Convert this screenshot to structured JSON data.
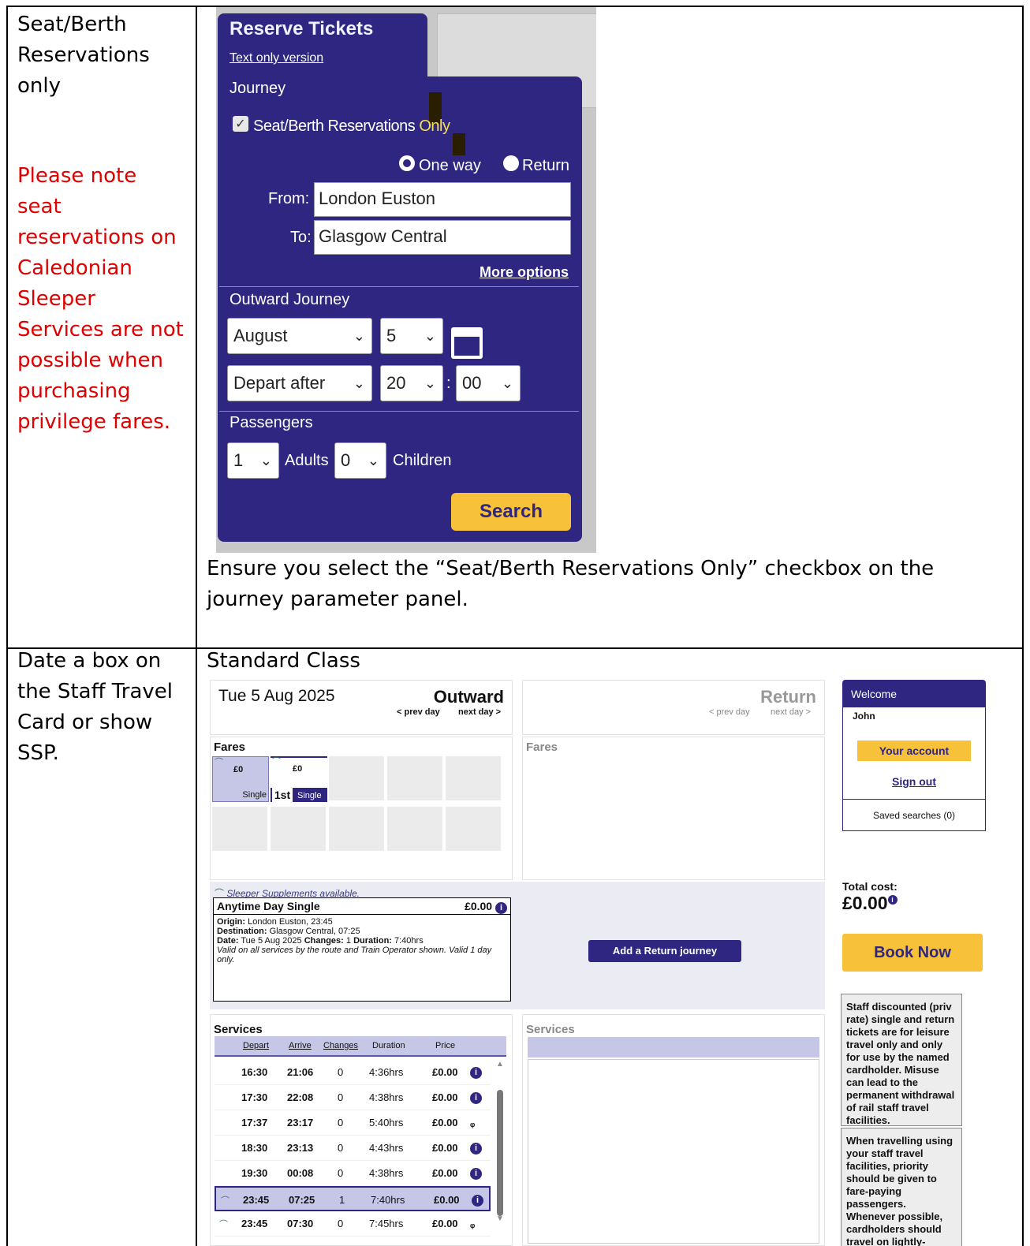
{
  "row1": {
    "label": "Seat/Berth Reservations only",
    "note": "Please note seat reservations on Caledonian Sleeper Services are not possible when purchasing privilege fares.",
    "caption": "Ensure you select the “Seat/Berth Reservations Only” checkbox on the journey parameter panel."
  },
  "reserve": {
    "title": "Reserve Tickets",
    "text_only_link": "Text only version",
    "journey_heading": "Journey",
    "checkbox_label_main": "Seat/Berth Reservations ",
    "checkbox_label_hl": "Only",
    "checkbox_checked": true,
    "one_way": "One way",
    "return": "Return",
    "from_label": "From:",
    "from_value": "London Euston",
    "to_label": "To:",
    "to_value": "Glasgow Central",
    "more_options": "More options",
    "outward_heading": "Outward Journey",
    "month": "August",
    "day": "5",
    "depart_mode": "Depart after",
    "hour": "20",
    "time_sep": ":",
    "minute": "00",
    "passengers_heading": "Passengers",
    "adults_count": "1",
    "adults_label": "Adults",
    "children_count": "0",
    "children_label": "Children",
    "search": "Search",
    "checkmark": "✓",
    "chevron": "⌄"
  },
  "row2": {
    "label": "Date a box on the Staff Travel Card or show SSP.",
    "heading": "Standard Class"
  },
  "booking": {
    "date": "Tue 5 Aug 2025",
    "outward": "Outward",
    "prev_day": "< prev day",
    "next_day": "next day >",
    "return": "Return",
    "fares": "Fares",
    "fare1_price": "£0",
    "fare1_type": "Single",
    "fare2_price": "£0",
    "fare2_class": "1st",
    "fare2_type": "Single",
    "sleeper_note": "Sleeper Supplements available.",
    "ticket_name": "Anytime Day Single",
    "ticket_price": "£0.00",
    "origin_label": "Origin:",
    "origin_value": " London Euston, 23:45",
    "destination_label": "Destination:",
    "destination_value": " Glasgow Central, 07:25",
    "date_label": "Date:",
    "date_value": " Tue 5 Aug 2025 ",
    "changes_label": "Changes:",
    "changes_value": " 1 ",
    "duration_label": "Duration:",
    "duration_value": " 7:40hrs",
    "validity": "Valid on all services by the route and Train Operator shown. Valid 1 day only.",
    "add_return": "Add a Return journey",
    "services": "Services",
    "columns": [
      "Depart",
      "Arrive",
      "Changes",
      "Duration",
      "Price"
    ],
    "rows": [
      {
        "depart": "16:30",
        "arrive": "21:06",
        "changes": "0",
        "duration": "4:36hrs",
        "price": "£0.00",
        "icon": "info"
      },
      {
        "depart": "17:30",
        "arrive": "22:08",
        "changes": "0",
        "duration": "4:38hrs",
        "price": "£0.00",
        "icon": "info"
      },
      {
        "depart": "17:37",
        "arrive": "23:17",
        "changes": "0",
        "duration": "5:40hrs",
        "price": "£0.00",
        "icon": "bus"
      },
      {
        "depart": "18:30",
        "arrive": "23:13",
        "changes": "0",
        "duration": "4:43hrs",
        "price": "£0.00",
        "icon": "info"
      },
      {
        "depart": "19:30",
        "arrive": "00:08",
        "changes": "0",
        "duration": "4:38hrs",
        "price": "£0.00",
        "icon": "info"
      },
      {
        "depart": "23:45",
        "arrive": "07:25",
        "changes": "1",
        "duration": "7:40hrs",
        "price": "£0.00",
        "icon": "info",
        "sleeper": true,
        "selected": true
      },
      {
        "depart": "23:45",
        "arrive": "07:30",
        "changes": "0",
        "duration": "7:45hrs",
        "price": "£0.00",
        "icon": "bus",
        "sleeper": true
      }
    ],
    "welcome": "Welcome",
    "user": "John",
    "your_account": "Your account",
    "sign_out": "Sign out",
    "saved_searches": "Saved searches (0)",
    "total_label": "Total cost:",
    "total_value": "£0.00",
    "book_now": "Book Now",
    "notice1": "Staff discounted (priv rate) single and return tickets are for leisure travel only and only for use by the named cardholder. Misuse can lead to the permanent withdrawal of rail staff travel facilities.",
    "notice2": "When travelling using your staff travel facilities, priority should be given to fare-paying passengers. Whenever possible, cardholders should travel on lightly-loaded trains. If a train",
    "info_glyph": "i",
    "bus_glyph": "ᵩ",
    "sleeper_glyph": "⌒",
    "scroll_up": "▲",
    "scroll_down": "▼"
  }
}
